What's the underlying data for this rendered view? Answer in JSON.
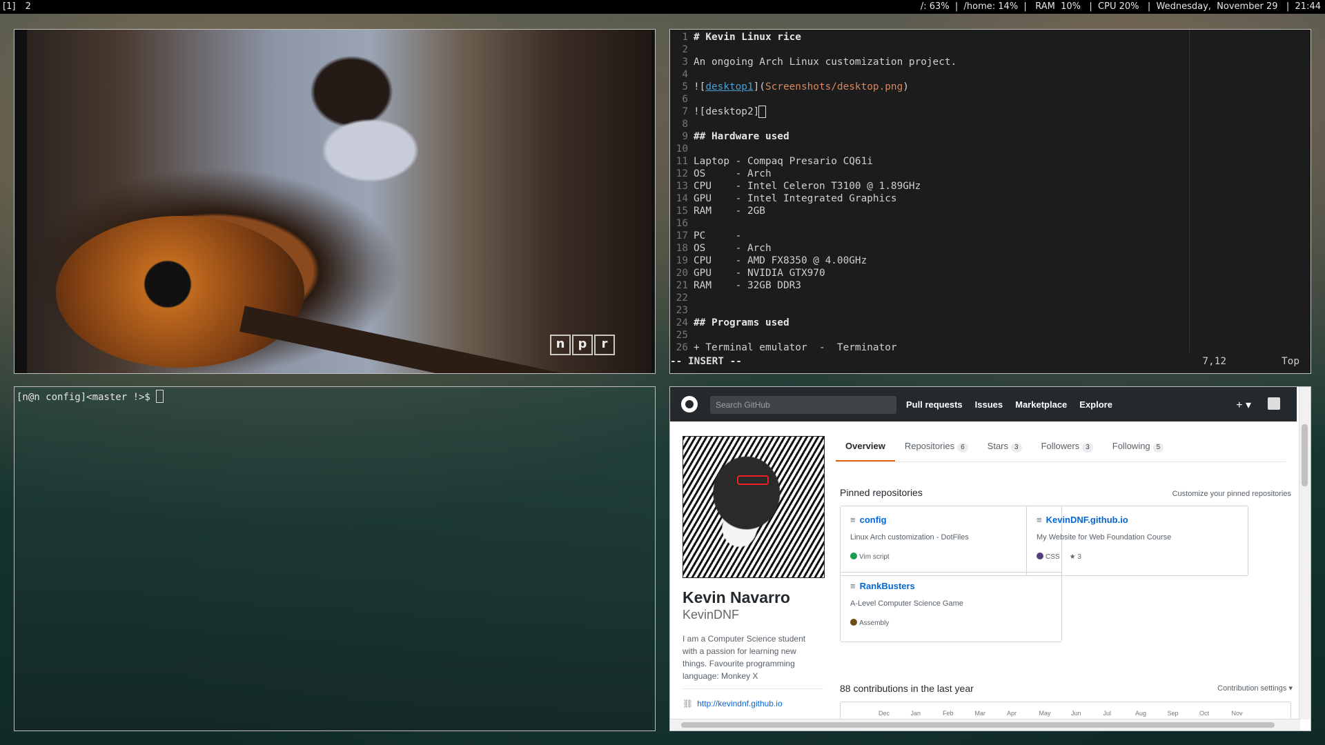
{
  "topbar": {
    "workspaces": [
      "[1]",
      "2"
    ],
    "stats": "/: 63%  |  /home: 14%  |   RAM  10%   |  CPU 20%   |  Wednesday,  November 29   |  21:44"
  },
  "video": {
    "logo": [
      "n",
      "p",
      "r"
    ]
  },
  "vim": {
    "lines": [
      {
        "n": "1",
        "t": "# Kevin Linux rice",
        "style": "b"
      },
      {
        "n": "2",
        "t": ""
      },
      {
        "n": "3",
        "t": "An ongoing Arch Linux customization project."
      },
      {
        "n": "4",
        "t": ""
      },
      {
        "n": "5",
        "t": "![desktop1](Screenshots/desktop.png)",
        "style": "link"
      },
      {
        "n": "6",
        "t": ""
      },
      {
        "n": "7",
        "t": "![desktop2]",
        "style": "cursor"
      },
      {
        "n": "8",
        "t": ""
      },
      {
        "n": "9",
        "t": "## Hardware used",
        "style": "b"
      },
      {
        "n": "10",
        "t": ""
      },
      {
        "n": "11",
        "t": "Laptop - Compaq Presario CQ61i"
      },
      {
        "n": "12",
        "t": "OS     - Arch"
      },
      {
        "n": "13",
        "t": "CPU    - Intel Celeron T3100 @ 1.89GHz"
      },
      {
        "n": "14",
        "t": "GPU    - Intel Integrated Graphics"
      },
      {
        "n": "15",
        "t": "RAM    - 2GB"
      },
      {
        "n": "16",
        "t": ""
      },
      {
        "n": "17",
        "t": "PC     -"
      },
      {
        "n": "18",
        "t": "OS     - Arch"
      },
      {
        "n": "19",
        "t": "CPU    - AMD FX8350 @ 4.00GHz"
      },
      {
        "n": "20",
        "t": "GPU    - NVIDIA GTX970"
      },
      {
        "n": "21",
        "t": "RAM    - 32GB DDR3"
      },
      {
        "n": "22",
        "t": ""
      },
      {
        "n": "23",
        "t": ""
      },
      {
        "n": "24",
        "t": "## Programs used",
        "style": "b"
      },
      {
        "n": "25",
        "t": ""
      },
      {
        "n": "26",
        "t": "+ Terminal emulator  -  Terminator"
      }
    ],
    "mode": "-- INSERT --",
    "cursor_pos": "7,12",
    "scroll_pos": "Top"
  },
  "terminal": {
    "prompt": "[n@n config]<master !>$ "
  },
  "github": {
    "search_placeholder": "Search GitHub",
    "nav": [
      "Pull requests",
      "Issues",
      "Marketplace",
      "Explore"
    ],
    "plus": "+ ▾",
    "name": "Kevin Navarro",
    "username": "KevinDNF",
    "bio": "I am a Computer Science student with a passion for learning new things. Favourite programming language: Monkey X",
    "website": "http://kevindnf.github.io",
    "tabs": [
      {
        "label": "Overview",
        "count": ""
      },
      {
        "label": "Repositories",
        "count": "6"
      },
      {
        "label": "Stars",
        "count": "3"
      },
      {
        "label": "Followers",
        "count": "3"
      },
      {
        "label": "Following",
        "count": "5"
      }
    ],
    "pinned_heading": "Pinned repositories",
    "customize": "Customize your pinned repositories",
    "repos": [
      {
        "name": "config",
        "desc": "Linux Arch customization - DotFiles",
        "lang": "Vim script",
        "color": "#199c4b",
        "stars": ""
      },
      {
        "name": "KevinDNF.github.io",
        "desc": "My Website for Web Foundation Course",
        "lang": "CSS",
        "color": "#563d7c",
        "stars": "3"
      },
      {
        "name": "RankBusters",
        "desc": "A-Level Computer Science Game",
        "lang": "Assembly",
        "color": "#6e4c13",
        "stars": ""
      }
    ],
    "contributions": "88 contributions in the last year",
    "contrib_settings": "Contribution settings ▾",
    "months": [
      "Dec",
      "Jan",
      "Feb",
      "Mar",
      "Apr",
      "May",
      "Jun",
      "Jul",
      "Aug",
      "Sep",
      "Oct",
      "Nov"
    ]
  }
}
